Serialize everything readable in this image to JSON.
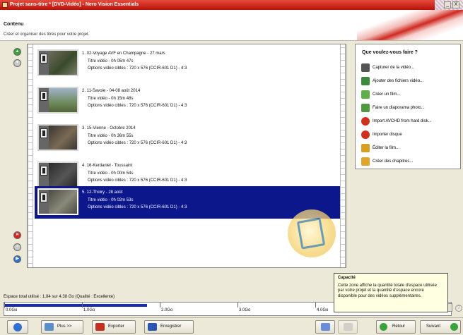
{
  "window": {
    "title": "Projet sans-titre * [DVD-Vidéo] - Nero Vision Essentials",
    "min_label": "_",
    "close_label": "X"
  },
  "header": {
    "title": "Contenu",
    "subtitle": "Créer et organiser des titres pour votre projet."
  },
  "titles": [
    {
      "line1": "1. 02-Voyage AVF en Champagne - 27 mars",
      "line2": "Titre vidéo - 0h 05m 47s",
      "line3": "Options vidéo cibles : 720 x 576 (CCIR-601 D1) - 4:3",
      "selected": false
    },
    {
      "line1": "2. 11-Savoie - 04-08 août 2014",
      "line2": "Titre vidéo - 0h 15m 48s",
      "line3": "Options vidéo cibles : 720 x 576 (CCIR-601 D1) - 4:3",
      "selected": false
    },
    {
      "line1": "3. 15-Vienne - Octobre 2014",
      "line2": "Titre vidéo - 0h 36m 55s",
      "line3": "Options vidéo cibles : 720 x 576 (CCIR-601 D1) - 4:3",
      "selected": false
    },
    {
      "line1": "4. 16-Kerdaniel - Toussaint",
      "line2": "Titre vidéo - 0h 00m 54s",
      "line3": "Options vidéo cibles : 720 x 576 (CCIR-601 D1) - 4:3",
      "selected": false
    },
    {
      "line1": "5. 12-Thoiry - 28 août",
      "line2": "Titre vidéo - 0h 02m 53s",
      "line3": "Options vidéo cibles : 720 x 576 (CCIR-601 D1) - 4:3",
      "selected": true
    }
  ],
  "actions": {
    "title": "Que voulez-vous faire ?",
    "items": [
      {
        "label": "Capturer de la vidéo...",
        "icon": "camera-icon"
      },
      {
        "label": "Ajouter des fichiers vidéo...",
        "icon": "add-video-icon"
      },
      {
        "label": "Créer un film...",
        "icon": "film-icon"
      },
      {
        "label": "Faire un diaporama photo...",
        "icon": "slideshow-icon"
      },
      {
        "label": "Import AVCHD from hard disk...",
        "icon": "import-avchd-icon"
      },
      {
        "label": "Importer disque",
        "icon": "import-disc-icon"
      },
      {
        "label": "Éditer la film...",
        "icon": "edit-film-icon"
      },
      {
        "label": "Créer des chapitres...",
        "icon": "chapters-icon"
      }
    ]
  },
  "capacity": {
    "status": "Espace total utilisé : 1.84 sur 4.38 Go (Qualité : Excellente)",
    "used_gb": 1.84,
    "total_gb": 4.38,
    "ticks": [
      "0.0Go",
      "1.0Go",
      "2.0Go",
      "3.0Go",
      "4.0Go"
    ]
  },
  "tooltip": {
    "title": "Capacité",
    "text": "Cette zone affiche la quantité totale d'espace utilisée par votre projet et la quantité d'espace encore disponible pour des vidéos supplémentaires."
  },
  "toolbar": {
    "more_label": "Plus >>",
    "export_label": "Exporter",
    "save_label": "Enregistrer",
    "back_label": "Retour",
    "next_label": "Suivant"
  },
  "colors": {
    "selection": "#0b178b",
    "titlebar": "#c8221a",
    "capacity_fill": "#1b2bb4"
  }
}
